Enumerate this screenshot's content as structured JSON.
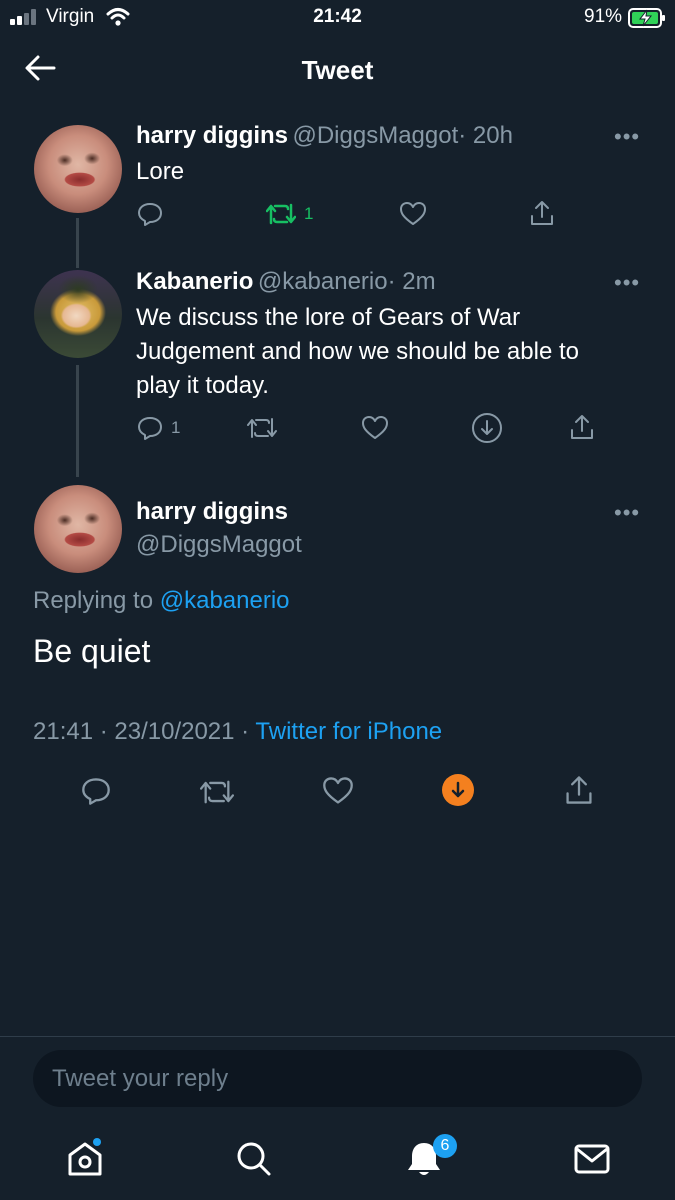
{
  "status_bar": {
    "carrier": "Virgin",
    "time": "21:42",
    "battery": "91%"
  },
  "header": {
    "title": "Tweet",
    "back_icon": "arrow-left-icon"
  },
  "thread": [
    {
      "name": "harry diggins",
      "handle": "@DiggsMaggot",
      "time": "· 20h",
      "text": "Lore",
      "retweet_count": "1",
      "retweeted": true
    },
    {
      "name": "Kabanerio",
      "handle": "@kabanerio",
      "time": "· 2m",
      "text_lines": [
        "We discuss the lore of Gears of War",
        "Judgement and how we should be able to",
        "play it today."
      ],
      "reply_count": "1"
    }
  ],
  "main_tweet": {
    "name": "harry diggins",
    "handle": "@DiggsMaggot",
    "replying_prefix": "Replying to",
    "replying_to": "@kabanerio",
    "text": "Be quiet",
    "timestamp": "21:41 · 23/10/2021 ·",
    "source": "Twitter for iPhone"
  },
  "reply_box": {
    "placeholder": "Tweet your reply"
  },
  "tab_bar": {
    "notifications_badge": "6"
  },
  "colors": {
    "background": "#15202b",
    "accent": "#1da1f2",
    "retweet_green": "#17bf63",
    "download_orange": "#f4801f",
    "muted": "#8899a6"
  }
}
